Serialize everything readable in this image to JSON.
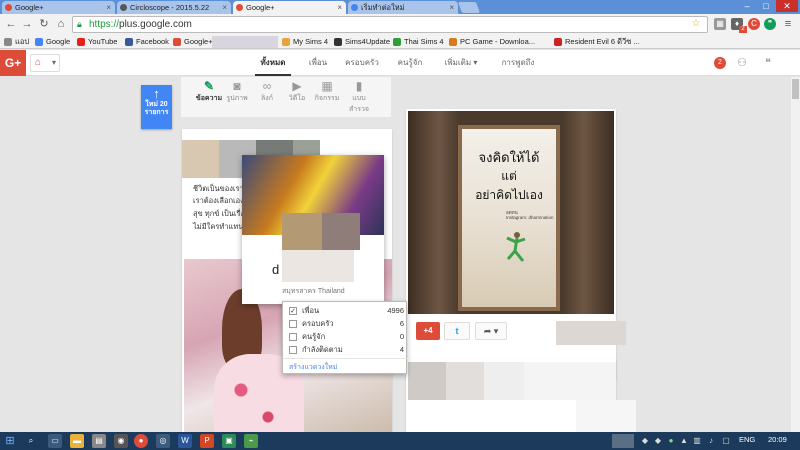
{
  "browser": {
    "tabs": [
      {
        "title": "Google+",
        "active": false,
        "icon": "gplus-favicon",
        "color": "#dd4b39"
      },
      {
        "title": "Circloscope - 2015.5.22",
        "active": false,
        "icon": "circloscope-favicon",
        "color": "#555555"
      },
      {
        "title": "Google+",
        "active": true,
        "icon": "gplus-favicon",
        "color": "#dd4b39"
      },
      {
        "title": "เริ่มทำต่อใหม่",
        "active": false,
        "icon": "new-tab-favicon",
        "color": "#4285f4"
      }
    ],
    "address": {
      "scheme": "https://",
      "host": "plus.google.com"
    },
    "extension_badges": {
      "extension_2": "2"
    },
    "bookmarks": [
      {
        "label": "แอป",
        "icon": "apps-icon",
        "color": "#888888"
      },
      {
        "label": "Google",
        "icon": "google-icon",
        "color": "#4285f4"
      },
      {
        "label": "YouTube",
        "icon": "youtube-icon",
        "color": "#e62117"
      },
      {
        "label": "Facebook",
        "icon": "facebook-icon",
        "color": "#3b5998"
      },
      {
        "label": "Google+",
        "icon": "gplus-icon",
        "color": "#dd4b39"
      },
      {
        "label": "My Sims 4",
        "icon": "folder-icon",
        "color": "#e8a33c"
      },
      {
        "label": "Sims4Update",
        "icon": "sims-icon",
        "color": "#333333"
      },
      {
        "label": "Thai Sims 4",
        "icon": "thai-sims-icon",
        "color": "#2e9d3a"
      },
      {
        "label": "PC Game - Downloa...",
        "icon": "pcgame-icon",
        "color": "#d67a1e"
      },
      {
        "label": "Resident Evil 6 ดีวีซ ...",
        "icon": "re6-icon",
        "color": "#cc2222"
      }
    ]
  },
  "gplus": {
    "logo": "G+",
    "tabs": [
      "ทั้งหมด",
      "เพื่อน",
      "ครอบครัว",
      "คนรู้จัก",
      "เพิ่มเติม",
      "การพูดถึง"
    ],
    "active_tab": "ทั้งหมด",
    "more_chevron": "▾",
    "notification_count": "2",
    "new_posts": {
      "arrow": "↑",
      "line1": "ใหม่ 20",
      "line2": "รายการ"
    },
    "share_options": [
      {
        "label": "ข้อความ",
        "icon": "pencil-icon",
        "glyph": "✎"
      },
      {
        "label": "รูปภาพ",
        "icon": "camera-icon",
        "glyph": "◙"
      },
      {
        "label": "ลิงก์",
        "icon": "link-icon",
        "glyph": "∞"
      },
      {
        "label": "วิดีโอ",
        "icon": "video-icon",
        "glyph": "▶"
      },
      {
        "label": "กิจกรรม",
        "icon": "calendar-icon",
        "glyph": "▦"
      },
      {
        "label": "แบบสำรวจ",
        "icon": "poll-icon",
        "glyph": "▮"
      }
    ]
  },
  "posts": {
    "left_snippets": [
      "ชีวิตเป็นของเรา",
      "เราต้องเลือกเอง",
      "สุข ทุกข์ เป็นเรื่อง",
      "ไม่มีใครทำแทน"
    ],
    "poster_lines": [
      "จงคิดให้ได้",
      "แต่",
      "อย่าคิดไปเอง"
    ],
    "poster_credit": [
      "อดทน",
      "Instagram: dharmnation"
    ],
    "plus_one": "+4",
    "twitter_glyph": "t",
    "share_glyph": "➦"
  },
  "hovercard": {
    "name": "d",
    "subtitle": "สมุทรสาคร Thailand"
  },
  "circles_dropdown": {
    "rows": [
      {
        "label": "เพื่อน",
        "count": "4996",
        "checked": true
      },
      {
        "label": "ครอบครัว",
        "count": "6",
        "checked": false
      },
      {
        "label": "คนรู้จัก",
        "count": "0",
        "checked": false
      },
      {
        "label": "กำลังติดตาม",
        "count": "4",
        "checked": false
      }
    ],
    "create_label": "สร้างแวดวงใหม่"
  },
  "taskbar": {
    "language": "ENG",
    "clock": "20:09"
  }
}
